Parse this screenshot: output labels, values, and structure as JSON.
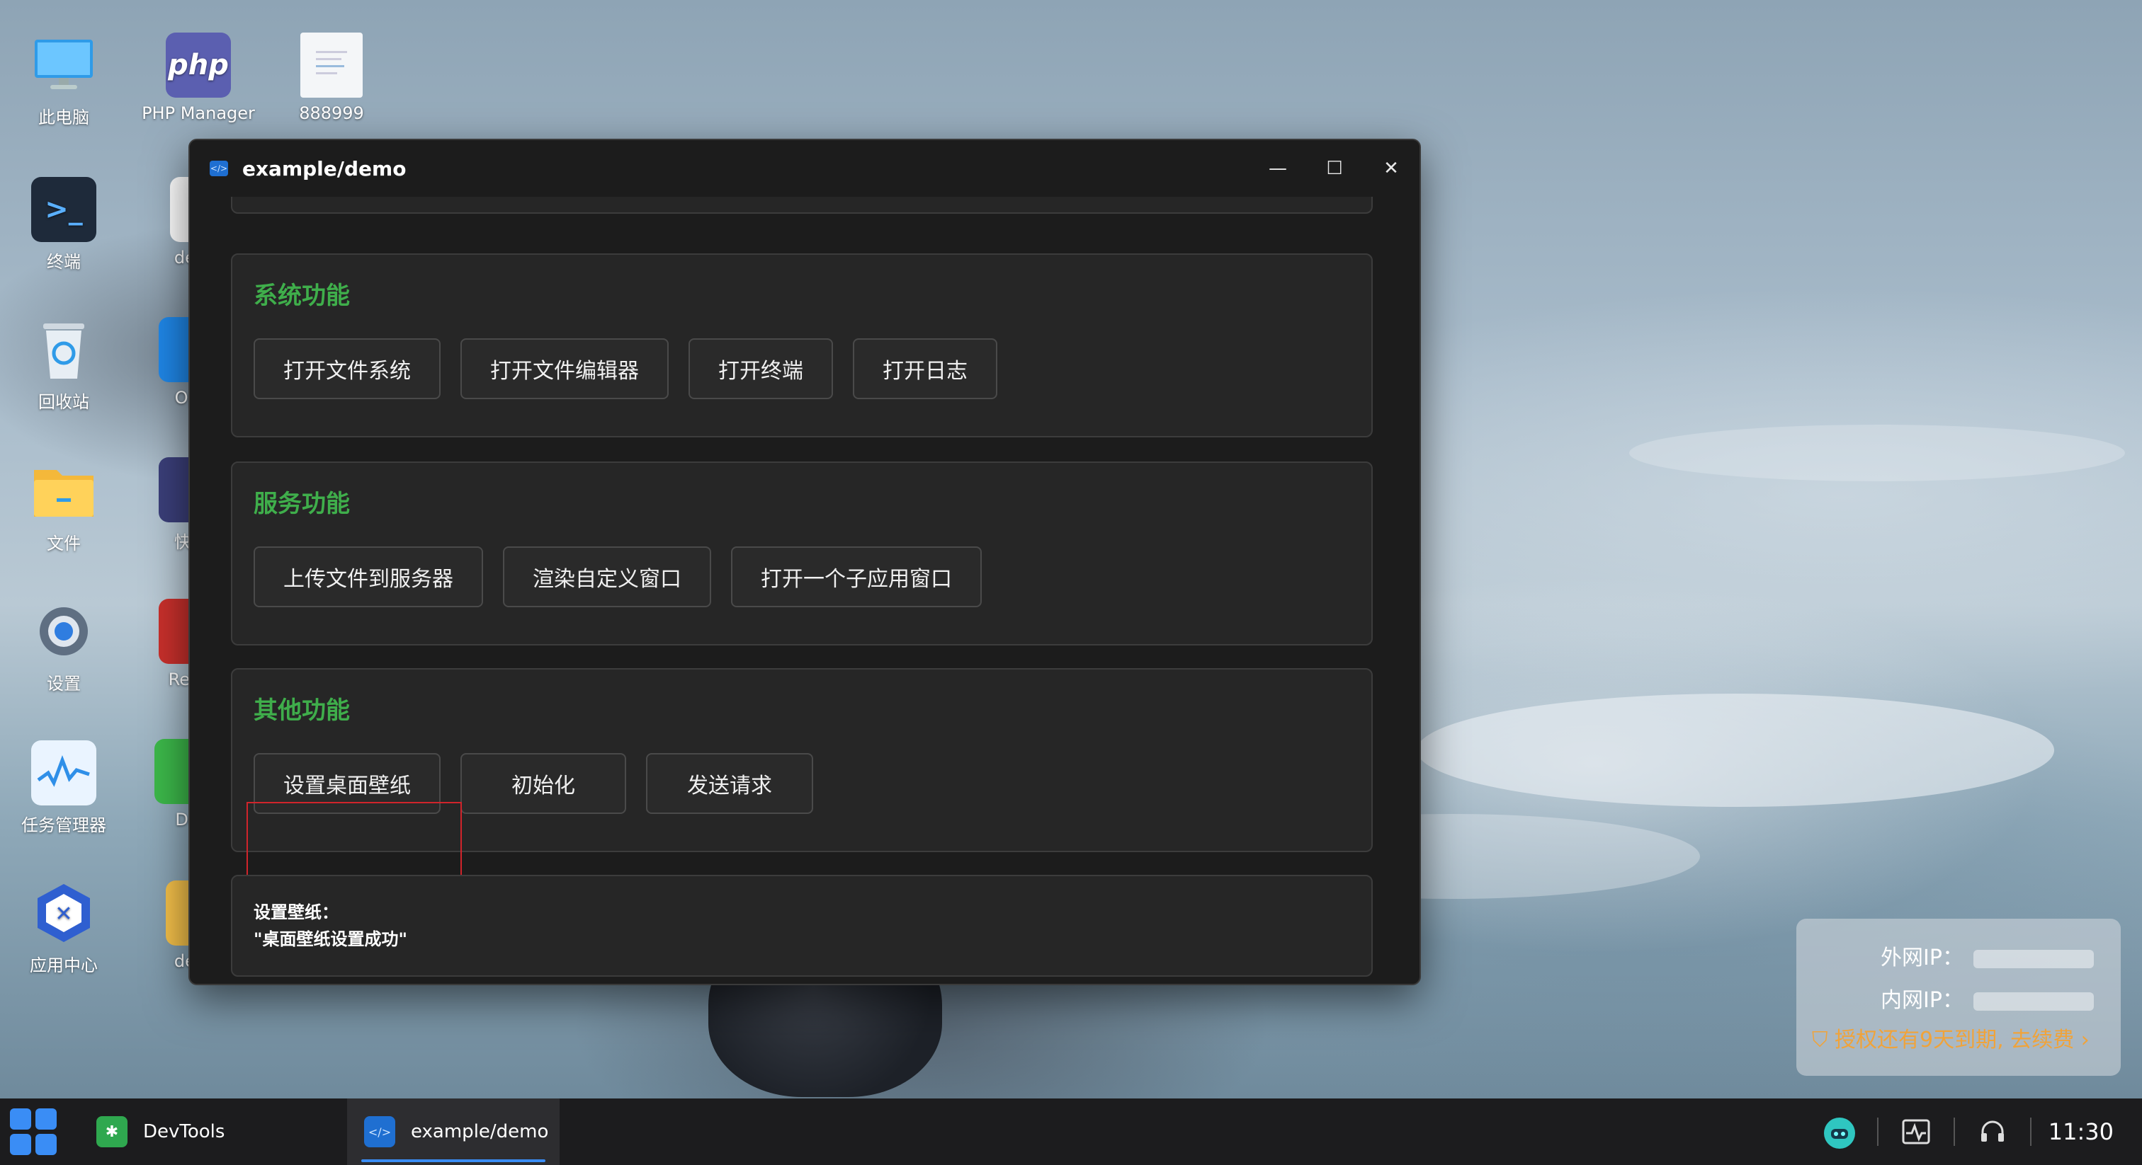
{
  "desktop": {
    "icons": [
      {
        "label": "此电脑",
        "icon": "computer-icon"
      },
      {
        "label": "PHP Manager",
        "icon": "php-icon"
      },
      {
        "label": "888999",
        "icon": "document-icon"
      },
      {
        "label": "终端",
        "icon": "terminal-icon"
      },
      {
        "label": "devto",
        "icon": "folder-icon"
      },
      {
        "label": "回收站",
        "icon": "recycle-bin-icon"
      },
      {
        "label": "Ops",
        "icon": "ops-icon"
      },
      {
        "label": "文件",
        "icon": "folder-icon"
      },
      {
        "label": "快捷",
        "icon": "shortcut-icon"
      },
      {
        "label": "设置",
        "icon": "gear-icon"
      },
      {
        "label": "Redis",
        "icon": "redis-icon"
      },
      {
        "label": "任务管理器",
        "icon": "task-manager-icon"
      },
      {
        "label": "De",
        "icon": "devtools-icon"
      },
      {
        "label": "应用中心",
        "icon": "app-center-icon"
      },
      {
        "label": "devto",
        "icon": "folder-icon"
      }
    ]
  },
  "window": {
    "title": "example/demo",
    "controls": {
      "minimize": "—",
      "maximize": "☐",
      "close": "✕"
    },
    "sections": [
      {
        "title": "系统功能",
        "buttons": [
          "打开文件系统",
          "打开文件编辑器",
          "打开终端",
          "打开日志"
        ]
      },
      {
        "title": "服务功能",
        "buttons": [
          "上传文件到服务器",
          "渲染自定义窗口",
          "打开一个子应用窗口"
        ]
      },
      {
        "title": "其他功能",
        "buttons": [
          "设置桌面壁纸",
          "初始化",
          "发送请求"
        ]
      }
    ],
    "result": {
      "label": "设置壁纸：",
      "value": "\"桌面壁纸设置成功\""
    }
  },
  "license": {
    "public_ip_label": "外网IP：",
    "private_ip_label": "内网IP：",
    "warning": "授权还有9天到期, 去续费"
  },
  "taskbar": {
    "apps": [
      {
        "label": "DevTools",
        "active": false
      },
      {
        "label": "example/demo",
        "active": true
      }
    ],
    "clock": "11:30"
  }
}
